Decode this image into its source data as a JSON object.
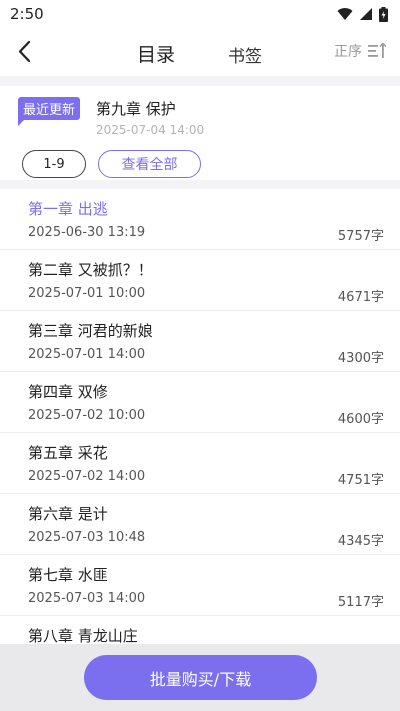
{
  "status_bar": {
    "time": "2:50"
  },
  "nav": {
    "tab_catalog": "目录",
    "tab_bookmark": "书签",
    "sort_label": "正序"
  },
  "recent": {
    "badge": "最近更新",
    "title": "第九章 保护",
    "time": "2025-07-04 14:00"
  },
  "range": {
    "current": "1-9",
    "view_all": "查看全部"
  },
  "chapters": [
    {
      "title": "第一章 出逃",
      "date": "2025-06-30 13:19",
      "words": "5757字"
    },
    {
      "title": "第二章 又被抓？！",
      "date": "2025-07-01 10:00",
      "words": "4671字"
    },
    {
      "title": "第三章 河君的新娘",
      "date": "2025-07-01 14:00",
      "words": "4300字"
    },
    {
      "title": "第四章 双修",
      "date": "2025-07-02 10:00",
      "words": "4600字"
    },
    {
      "title": "第五章 采花",
      "date": "2025-07-02 14:00",
      "words": "4751字"
    },
    {
      "title": "第六章 是计",
      "date": "2025-07-03 10:48",
      "words": "4345字"
    },
    {
      "title": "第七章 水匪",
      "date": "2025-07-03 14:00",
      "words": "5117字"
    },
    {
      "title": "第八章 青龙山庄",
      "date": "",
      "words": ""
    }
  ],
  "bottom": {
    "buy_label": "批量购买/下载"
  },
  "colors": {
    "accent": "#7b6ff0"
  },
  "icons": {
    "back": "chevron-left-icon",
    "sort": "sort-lines-icon",
    "wifi": "wifi-icon",
    "signal": "signal-icon",
    "battery": "battery-icon"
  }
}
